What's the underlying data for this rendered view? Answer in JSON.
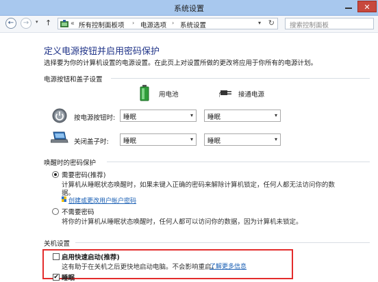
{
  "window": {
    "title": "系统设置",
    "close_glyph": "✕"
  },
  "nav": {
    "back_glyph": "←",
    "forward_glyph": "→",
    "up_glyph": "↑",
    "crumbs_prefix": "«",
    "crumbs": [
      "所有控制面板项",
      "电源选项",
      "系统设置"
    ],
    "separator": "›",
    "dropdown_glyph": "▾",
    "refresh_glyph": "↻",
    "search_placeholder": "搜索控制面板"
  },
  "page": {
    "heading": "定义电源按钮并启用密码保护",
    "intro": "选择要为你的计算机设置的电源设置。在此页上对设置所做的更改将应用于你所有的电源计划。"
  },
  "power_buttons": {
    "section_title": "电源按钮和盖子设置",
    "col_battery": "用电池",
    "col_plugged": "接通电源",
    "rows": [
      {
        "label": "按电源按钮时:",
        "battery": "睡眠",
        "plugged": "睡眠"
      },
      {
        "label": "关闭盖子时:",
        "battery": "睡眠",
        "plugged": "睡眠"
      }
    ],
    "arrow_glyph": "▾"
  },
  "wake_password": {
    "section_title": "唤醒时的密码保护",
    "options": [
      {
        "label": "需要密码(推荐)",
        "selected": true,
        "desc": "计算机从睡眠状态唤醒时，如果未键入正确的密码来解除计算机锁定，任何人都无法访问你的数",
        "desc2": "据。",
        "link": "创建或更改用户帐户密码"
      },
      {
        "label": "不需要密码",
        "selected": false,
        "desc": "将你的计算机从睡眠状态唤醒时，任何人都可以访问你的数据，因为计算机未锁定。"
      }
    ]
  },
  "shutdown": {
    "section_title": "关机设置",
    "fast_startup": {
      "label": "启用快速启动(推荐)",
      "checked": false,
      "desc": "这有助于在关机之后更快地启动电脑。不会影响重启。",
      "link": "了解更多信息"
    },
    "sleep": {
      "label": "睡眠",
      "checked": true,
      "check_glyph": "✔"
    }
  },
  "colors": {
    "heading": "#1e3287",
    "link": "#1a5fb4",
    "highlight_box": "#e32b2b",
    "titlebar": "#a8c8ee"
  }
}
